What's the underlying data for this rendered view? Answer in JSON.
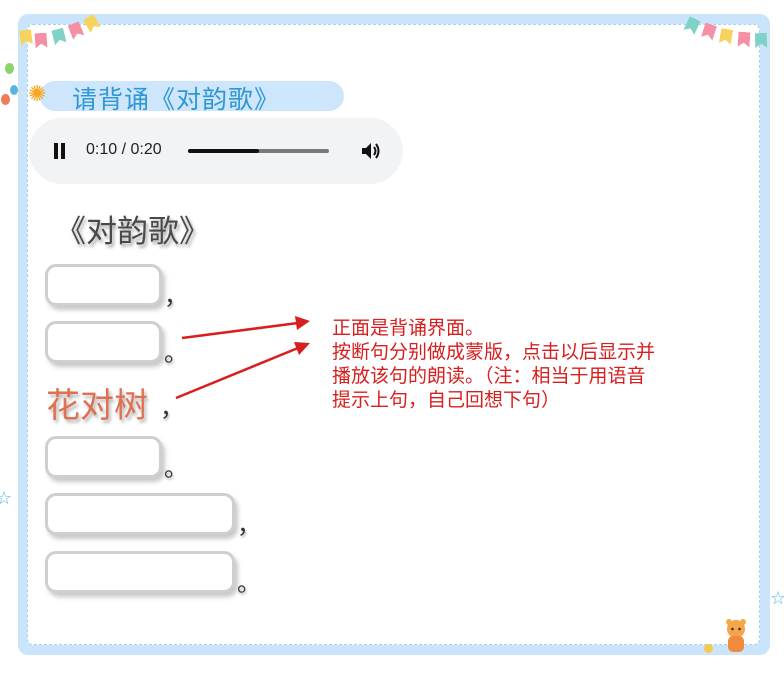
{
  "header": {
    "title": "请背诵《对韵歌》",
    "icon": "sun-flower-icon"
  },
  "audio_player": {
    "state": "playing",
    "time": "0:10 / 0:20",
    "progress": 0.5,
    "icons": [
      "pause-icon",
      "volume-icon"
    ]
  },
  "poem": {
    "title": "《对韵歌》",
    "lines": [
      {
        "state": "hidden",
        "text": "",
        "punct": "，"
      },
      {
        "state": "hidden",
        "text": "",
        "punct": "。"
      },
      {
        "state": "revealed",
        "text": "花对树",
        "punct": "，"
      },
      {
        "state": "hidden",
        "text": "",
        "punct": "。"
      },
      {
        "state": "hidden",
        "text": "",
        "punct": "，"
      },
      {
        "state": "hidden",
        "text": "",
        "punct": "。"
      }
    ]
  },
  "annotation": {
    "lines": [
      "正面是背诵界面。",
      "按断句分别做成蒙版，点击以后显示并",
      "播放该句的朗读。（注：相当于用语音",
      "提示上句，自己回想下句）"
    ]
  },
  "colors": {
    "frame": "#c9e4fb",
    "title": "#2f97d3",
    "revealed_text": "#e07052",
    "annotation": "#d81e1e",
    "mask_border": "#cfcfcf"
  }
}
